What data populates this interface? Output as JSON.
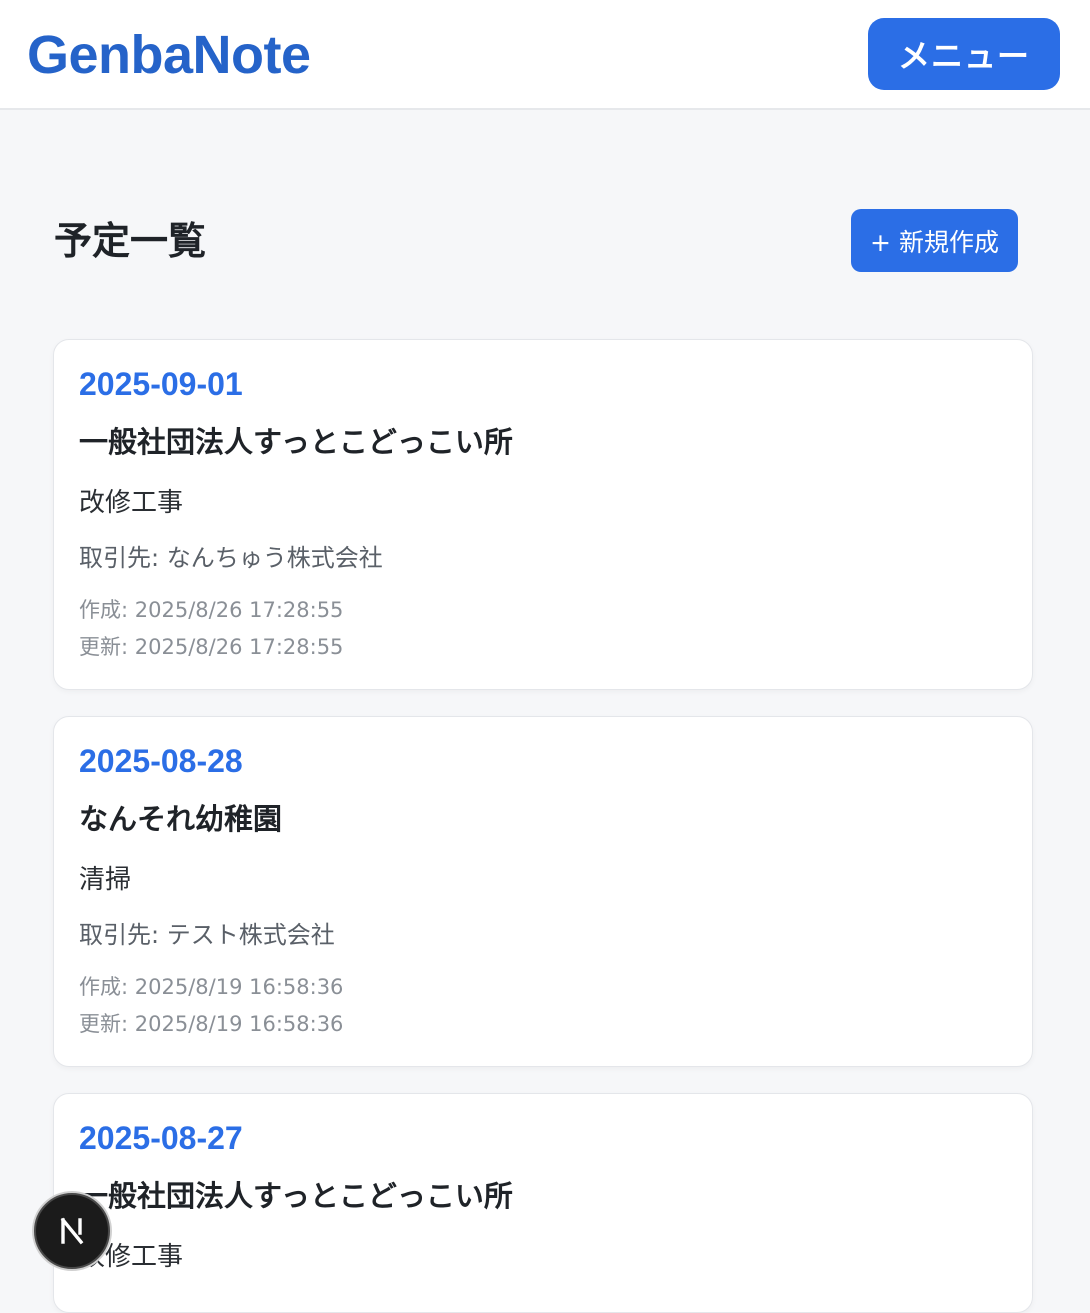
{
  "header": {
    "logo": "GenbaNote",
    "menu_label": "メニュー"
  },
  "main": {
    "title": "予定一覧",
    "new_button_label": "+ 新規作成",
    "schedules": [
      {
        "date": "2025-09-01",
        "name": "一般社団法人すっとこどっこい所",
        "work": "改修工事",
        "client": "取引先: なんちゅう株式会社",
        "created": "作成: 2025/8/26 17:28:55",
        "updated": "更新: 2025/8/26 17:28:55"
      },
      {
        "date": "2025-08-28",
        "name": "なんそれ幼稚園",
        "work": "清掃",
        "client": "取引先: テスト株式会社",
        "created": "作成: 2025/8/19 16:58:36",
        "updated": "更新: 2025/8/19 16:58:36"
      },
      {
        "date": "2025-08-27",
        "name": "一般社団法人すっとこどっこい所",
        "work": "改修工事"
      }
    ]
  },
  "colors": {
    "accent": "#2b6ee6",
    "logo": "#2563c9",
    "background": "#f6f7f9"
  },
  "dev_badge": {
    "icon": "nextjs-logo-icon"
  }
}
